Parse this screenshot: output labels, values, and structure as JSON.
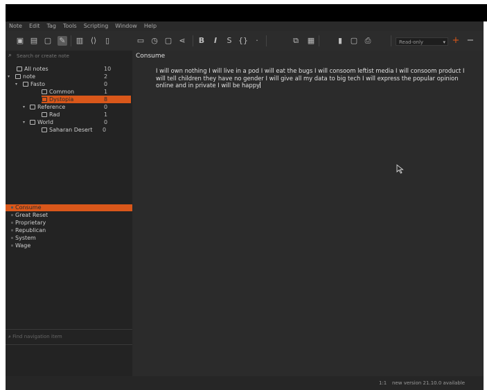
{
  "menu": [
    "Note",
    "Edit",
    "Tag",
    "Tools",
    "Scripting",
    "Window",
    "Help"
  ],
  "toolbar": {
    "mode": "Read-only"
  },
  "left": {
    "search_placeholder": "Search or create note",
    "tree": [
      {
        "label": "All notes",
        "count": "10"
      },
      {
        "label": "note",
        "count": "2"
      },
      {
        "label": "Fasto",
        "count": "0"
      },
      {
        "label": "Common",
        "count": "1"
      },
      {
        "label": "Dystopia",
        "count": "8"
      },
      {
        "label": "Reference",
        "count": "0"
      },
      {
        "label": "Rad",
        "count": "1"
      },
      {
        "label": "World",
        "count": "0"
      },
      {
        "label": "Saharan Desert",
        "count": "0"
      }
    ],
    "tags": [
      "Consume",
      "Great Reset",
      "Proprietary",
      "Republican",
      "System",
      "Wage"
    ],
    "nav_placeholder": "Find navigation item"
  },
  "editor": {
    "title": "Consume",
    "body": "I will own nothing I will live in a pod I will eat the bugs I will consoom leftist media I will consoom product I will tell children they have no gender I will give all my data to big tech I will express the popular opinion online and in private I will be happy"
  },
  "status": {
    "position": "1:1",
    "message": "new version 21.10.0 available"
  },
  "colors": {
    "accent": "#d9571a",
    "background": "#2a2a2a"
  }
}
